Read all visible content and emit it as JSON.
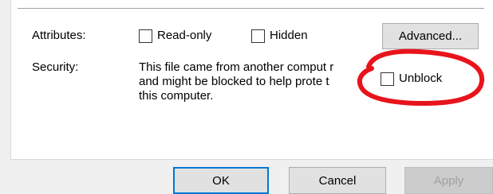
{
  "attributes": {
    "label": "Attributes:",
    "readonly_label": "Read-only",
    "hidden_label": "Hidden",
    "advanced_label": "Advanced..."
  },
  "security": {
    "label": "Security:",
    "message_lines": [
      "This file came from another comput r",
      "and might be blocked to help prote t",
      "this computer."
    ],
    "unblock_label": "Unblock"
  },
  "footer": {
    "ok_label": "OK",
    "cancel_label": "Cancel",
    "apply_label": "Apply"
  },
  "annotation": {
    "color": "#e8141c",
    "shape": "red-circle"
  }
}
